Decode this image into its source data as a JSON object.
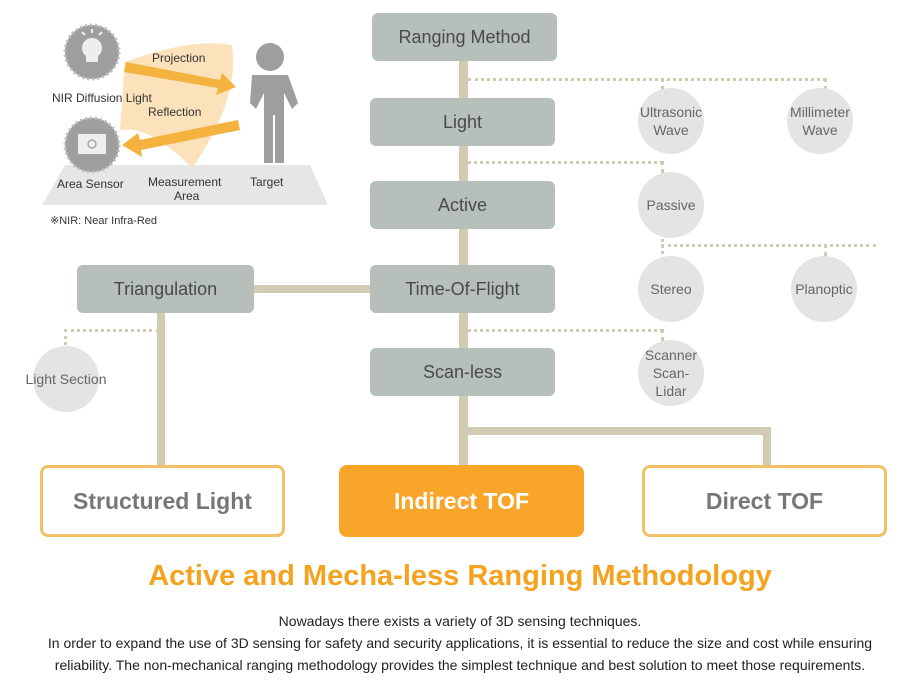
{
  "illustration": {
    "light_label": "NIR Diffusion Light",
    "projection_label": "Projection",
    "reflection_label": "Reflection",
    "sensor_label": "Area Sensor",
    "area_label_1": "Measurement",
    "area_label_2": "Area",
    "target_label": "Target",
    "footnote": "※NIR: Near Infra-Red"
  },
  "tree": {
    "boxes": {
      "ranging_method": "Ranging Method",
      "light": "Light",
      "active": "Active",
      "tof": "Time-Of-Flight",
      "scanless": "Scan-less",
      "triangulation": "Triangulation"
    },
    "circles": {
      "ultrasonic": [
        "Ultrasonic",
        "Wave"
      ],
      "millimeter": [
        "Millimeter",
        "Wave"
      ],
      "passive": "Passive",
      "stereo": "Stereo",
      "planoptic": "Planoptic",
      "scanner": [
        "Scanner",
        "Scan-Lidar"
      ],
      "light_section": "Light Section"
    }
  },
  "results": {
    "structured_light": "Structured  Light",
    "indirect_tof": "Indirect TOF",
    "direct_tof": "Direct TOF"
  },
  "headline": "Active and Mecha-less Ranging Methodology",
  "description": [
    "Nowadays there exists a variety of 3D sensing techniques.",
    "In order to expand the use of 3D sensing for safety and security applications, it is essential to reduce the size and cost while ensuring reliability. The non-mechanical ranging methodology provides the simplest technique and best solution to meet those requirements."
  ],
  "colors": {
    "accent": "#f8a52a",
    "box": "#b6bfb9",
    "connector": "#d1cbb3",
    "circle": "#e4e4e4"
  }
}
